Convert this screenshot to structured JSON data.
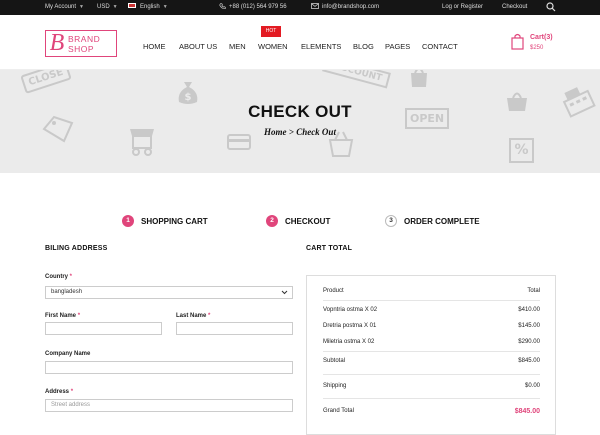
{
  "topbar": {
    "account": "My Account",
    "currency": "USD",
    "language": "English",
    "phone": "+88 (012) 564 979 56",
    "email": "info@brandshop.com",
    "login": "Log or Register",
    "checkout": "Checkout"
  },
  "logo": {
    "letter": "B",
    "line1": "BRAND",
    "line2": "SHOP"
  },
  "nav": {
    "items": [
      "HOME",
      "ABOUT US",
      "MEN",
      "WOMEN",
      "ELEMENTS",
      "BLOG",
      "PAGES",
      "CONTACT"
    ],
    "hot_badge": "HOT"
  },
  "cart": {
    "label": "Cart(3)",
    "price": "$250"
  },
  "banner": {
    "title": "CHECK OUT",
    "crumb_home": "Home",
    "crumb_sep": ">",
    "crumb_current": "Check Out",
    "sign_close": "CLOSE",
    "sign_discount": "DISCOUNT",
    "sign_open": "OPEN",
    "pct": "%"
  },
  "steps": [
    {
      "num": "1",
      "label": "SHOPPING CART"
    },
    {
      "num": "2",
      "label": "CHECKOUT"
    },
    {
      "num": "3",
      "label": "ORDER COMPLETE"
    }
  ],
  "billing": {
    "title": "BILING ADDRESS",
    "country_label": "Country",
    "country_value": "bangladesh",
    "first_name_label": "First Name",
    "last_name_label": "Last Name",
    "company_label": "Company Name",
    "address_label": "Address",
    "address_placeholder": "Street address",
    "required_mark": "*"
  },
  "cart_total": {
    "title": "CART TOTAL",
    "col_product": "Product",
    "col_total": "Total",
    "items": [
      {
        "name": "Vopntria ostma X 02",
        "price": "$410.00"
      },
      {
        "name": "Dretria postma X 01",
        "price": "$145.00"
      },
      {
        "name": "Miletria ostma X 02",
        "price": "$290.00"
      }
    ],
    "subtotal_label": "Subtotal",
    "subtotal": "$845.00",
    "shipping_label": "Shipping",
    "shipping": "$0.00",
    "grand_label": "Grand Total",
    "grand": "$845.00"
  },
  "colors": {
    "accent": "#e0457b",
    "topbar": "#151515",
    "banner": "#ebebeb"
  }
}
